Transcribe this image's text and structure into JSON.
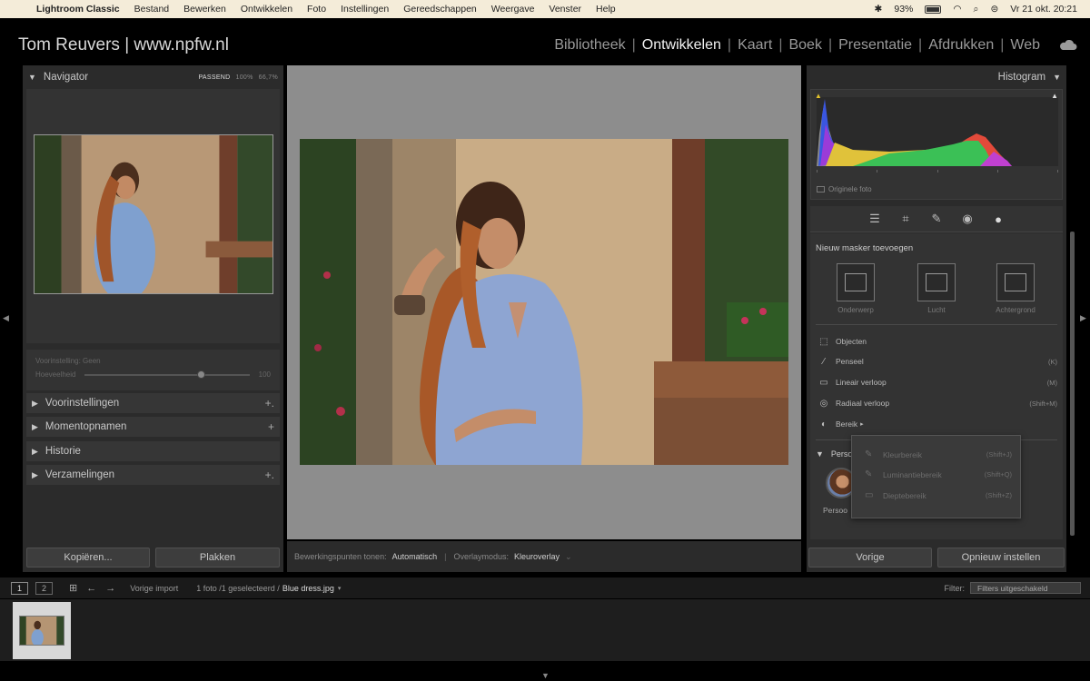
{
  "menubar": {
    "app": "Lightroom Classic",
    "items": [
      "Bestand",
      "Bewerken",
      "Ontwikkelen",
      "Foto",
      "Instellingen",
      "Gereedschappen",
      "Weergave",
      "Venster",
      "Help"
    ],
    "battery": "93%",
    "datetime": "Vr 21 okt.  20:21"
  },
  "header": {
    "identity": "Tom Reuvers | www.npfw.nl",
    "modules": [
      "Bibliotheek",
      "Ontwikkelen",
      "Kaart",
      "Boek",
      "Presentatie",
      "Afdrukken",
      "Web"
    ],
    "active_module": "Ontwikkelen"
  },
  "left": {
    "navigator": {
      "title": "Navigator",
      "zoom": [
        "PASSEND",
        "100%",
        "66,7%"
      ]
    },
    "preset_amount": {
      "label": "Voorinstelling: Geen",
      "slider_label": "Hoeveelheid",
      "value": "100",
      "level_fraction": 0.68
    },
    "sections": [
      {
        "label": "Voorinstellingen",
        "plus": "+."
      },
      {
        "label": "Momentopnamen",
        "plus": "+"
      },
      {
        "label": "Historie",
        "plus": ""
      },
      {
        "label": "Verzamelingen",
        "plus": "+."
      }
    ],
    "copy_button": "Kopiëren...",
    "paste_button": "Plakken"
  },
  "center": {
    "toolbar": {
      "edit_pins_label": "Bewerkingspunten tonen:",
      "edit_pins_value": "Automatisch",
      "overlay_label": "Overlaymodus:",
      "overlay_value": "Kleuroverlay"
    }
  },
  "right": {
    "histogram": {
      "title": "Histogram",
      "original_photo": "Originele foto"
    },
    "masking": {
      "title": "Nieuw masker toevoegen",
      "tiles": [
        "Onderwerp",
        "Lucht",
        "Achtergrond"
      ],
      "items": [
        {
          "label": "Objecten",
          "shortcut": ""
        },
        {
          "label": "Penseel",
          "shortcut": "(K)"
        },
        {
          "label": "Lineair verloop",
          "shortcut": "(M)"
        },
        {
          "label": "Radiaal verloop",
          "shortcut": "(Shift+M)"
        },
        {
          "label": "Bereik",
          "shortcut": ""
        }
      ],
      "people_label": "Perso",
      "avatar_label": "Persoo"
    },
    "submenu": [
      {
        "label": "Kleurbereik",
        "shortcut": "(Shift+J)"
      },
      {
        "label": "Luminantiebereik",
        "shortcut": "(Shift+Q)"
      },
      {
        "label": "Dieptebereik",
        "shortcut": "(Shift+Z)"
      }
    ],
    "previous_button": "Vorige",
    "reset_button": "Opnieuw instellen"
  },
  "filmstrip": {
    "view1": "1",
    "view2": "2",
    "source": "Vorige import",
    "info": "1 foto /1 geselecteerd /",
    "filename": "Blue dress.jpg",
    "filter_label": "Filter:",
    "filter_value": "Filters uitgeschakeld"
  }
}
